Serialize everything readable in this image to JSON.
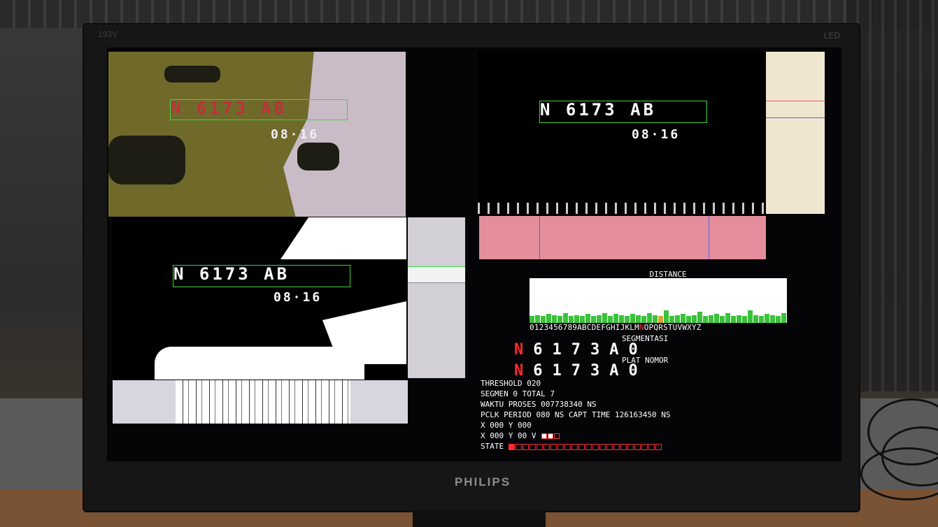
{
  "monitor": {
    "model": "193V",
    "panel": "LED",
    "brand": "PHILIPS"
  },
  "plates": [
    {
      "id": "q1",
      "text": "N 6173 AB",
      "date": "08·16"
    },
    {
      "id": "q2",
      "text": "N 6173 AB",
      "date": "08·16"
    },
    {
      "id": "q3",
      "text": "N 6173 AB",
      "date": "08·16"
    }
  ],
  "distance": {
    "title": "DISTANCE",
    "alphabet_pre": "0123456789ABCDEFGHIJKLM",
    "alphabet_hit": "N",
    "alphabet_post": "OPQRSTUVWXYZ",
    "levels": [
      0.3,
      0.35,
      0.3,
      0.4,
      0.35,
      0.3,
      0.45,
      0.3,
      0.35,
      0.3,
      0.4,
      0.3,
      0.35,
      0.45,
      0.3,
      0.4,
      0.35,
      0.3,
      0.4,
      0.35,
      0.3,
      0.45,
      0.35,
      0.3,
      0.55,
      0.3,
      0.35,
      0.4,
      0.3,
      0.35,
      0.5,
      0.3,
      0.35,
      0.4,
      0.3,
      0.45,
      0.3,
      0.35,
      0.3,
      0.55,
      0.35,
      0.3,
      0.4,
      0.35,
      0.3,
      0.45
    ],
    "bar_colors": {
      "normal": "#3ac23a",
      "hit": "#d9a030"
    }
  },
  "segmentation": {
    "label": "SEGMENTASI",
    "first": "N",
    "rest": "6173A0"
  },
  "plate_number": {
    "label": "PLAT NOMOR",
    "first": "N",
    "rest": "6173A0"
  },
  "info": {
    "threshold": "THRESHOLD 020",
    "segmen": "SEGMEN 0 TOTAL 7",
    "waktu": "WAKTU PROSES 007738340 NS",
    "pclk": "PCLK PERIOD 080 NS CAPT TIME 126163450 NS",
    "xy1": "X 000 Y 000",
    "xy2": "X 000 Y 00 V",
    "state": "STATE"
  },
  "state_cells": [
    1,
    0,
    0,
    0,
    0,
    0,
    0,
    0,
    0,
    0,
    0,
    0,
    0,
    0,
    0,
    0,
    0,
    0,
    0,
    0,
    0,
    0
  ],
  "v_cells": [
    1,
    1,
    0
  ]
}
